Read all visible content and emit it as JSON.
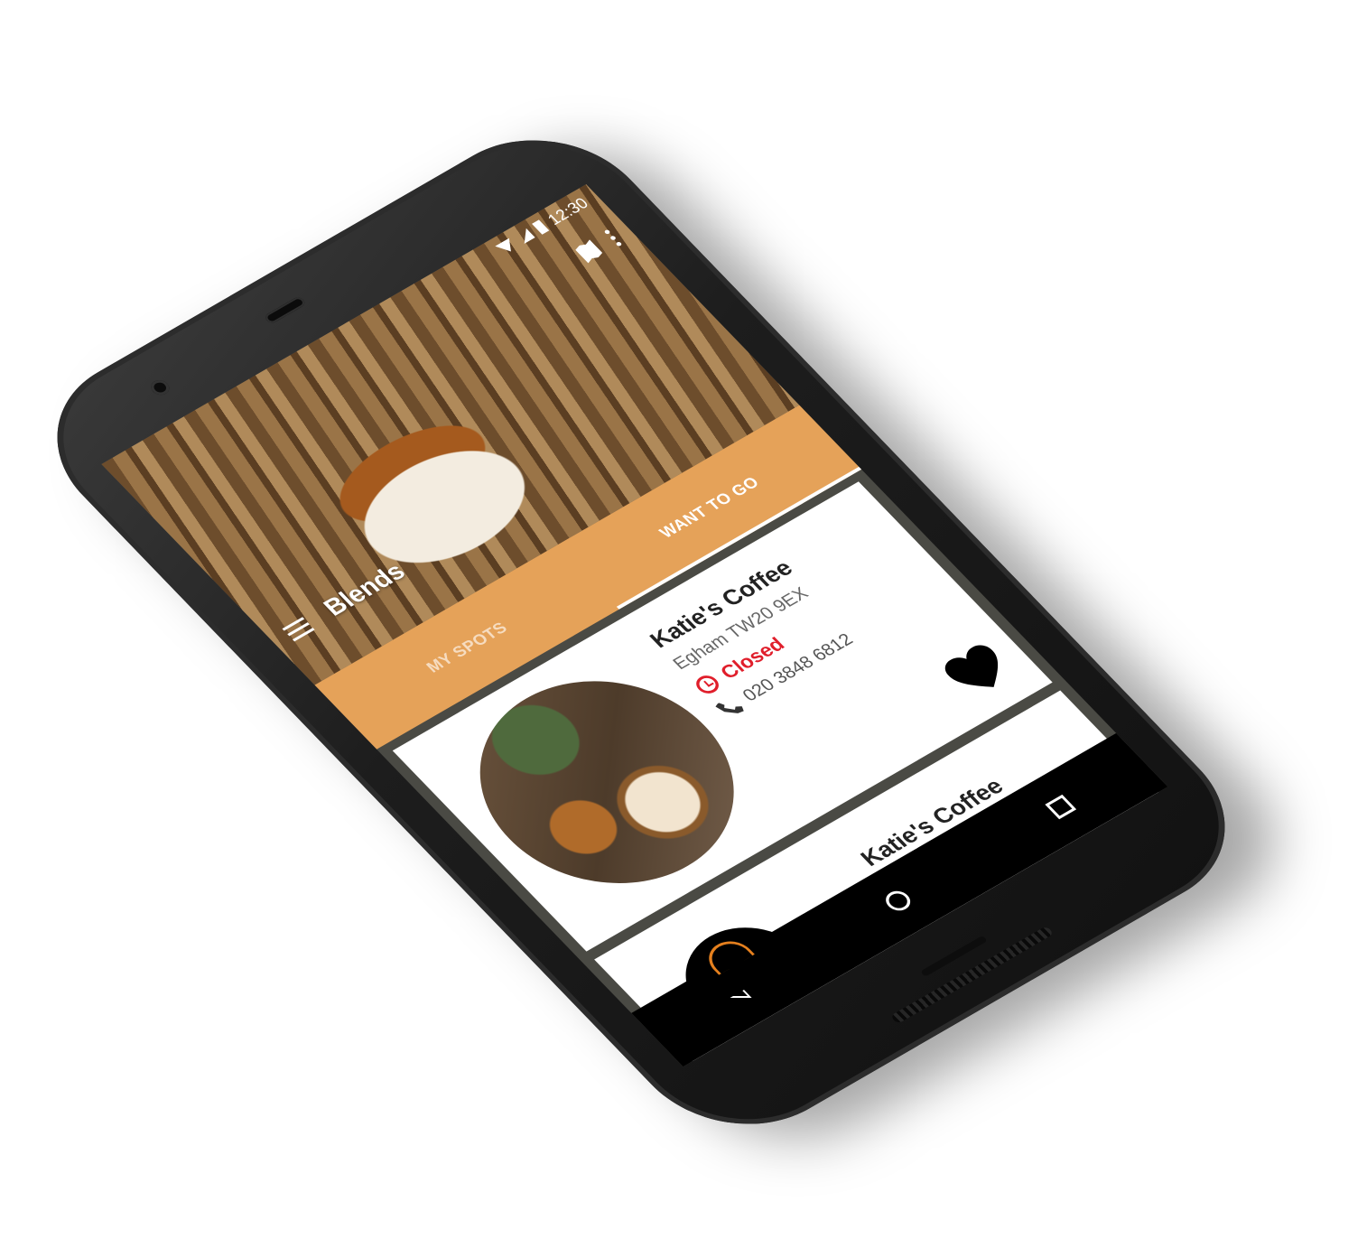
{
  "status_bar": {
    "time": "12:30"
  },
  "app": {
    "title": "Blends"
  },
  "tabs": [
    {
      "label": "MY SPOTS",
      "active": false
    },
    {
      "label": "WANT TO GO",
      "active": true
    }
  ],
  "cards": [
    {
      "name": "Katie's Coffee",
      "address": "Egham TW20 9EX",
      "status": "Closed",
      "phone": "020 3848 6812"
    },
    {
      "name": "Katie's Coffee"
    }
  ],
  "colors": {
    "accent": "#e5a259",
    "closed": "#e01e2b",
    "logo": "#e5801e"
  },
  "icons": {
    "menu": "hamburger-menu-icon",
    "map": "map-icon",
    "more": "more-vert-icon",
    "clock": "clock-icon",
    "phone": "phone-icon",
    "favorite": "heart-icon",
    "back": "back-icon",
    "home": "home-icon",
    "recent": "recent-apps-icon"
  }
}
